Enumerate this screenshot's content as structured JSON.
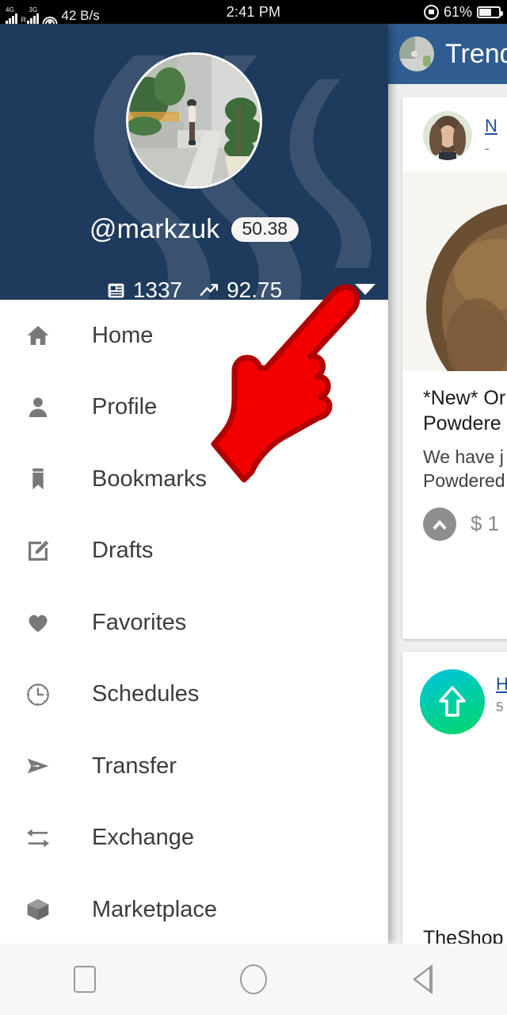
{
  "status_bar": {
    "network_4g": "4G",
    "network_3g": "3G",
    "roaming": "R",
    "data_rate": "42 B/s",
    "clock": "2:41 PM",
    "battery_percent": "61%",
    "icons": [
      "signal-4g-icon",
      "signal-3g-icon",
      "wifi-icon",
      "rotation-lock-icon",
      "battery-icon"
    ]
  },
  "drawer": {
    "profile": {
      "username": "@markzuk",
      "reputation": "50.38",
      "post_count": "1337",
      "voting_power": "92.75",
      "post_count_icon": "article-icon",
      "voting_power_icon": "trending-up-icon",
      "expand_icon": "caret-down-icon"
    },
    "menu": [
      {
        "label": "Home",
        "icon": "home-icon"
      },
      {
        "label": "Profile",
        "icon": "person-icon"
      },
      {
        "label": "Bookmarks",
        "icon": "bookmark-icon"
      },
      {
        "label": "Drafts",
        "icon": "edit-square-icon"
      },
      {
        "label": "Favorites",
        "icon": "heart-icon"
      },
      {
        "label": "Schedules",
        "icon": "clock-icon"
      },
      {
        "label": "Transfer",
        "icon": "send-arrow-icon"
      },
      {
        "label": "Exchange",
        "icon": "swap-arrows-icon"
      },
      {
        "label": "Marketplace",
        "icon": "cube-box-icon"
      }
    ]
  },
  "app_behind": {
    "app_bar": {
      "title": "Trend",
      "avatar_icon": "user-avatar"
    },
    "posts": [
      {
        "author": "N",
        "subtitle": "-",
        "title_line1": "*New* Or",
        "title_line2": "Powdere",
        "body_line1": "We have j",
        "body_line2": "Powdered",
        "upvote_icon": "upvote-chevron-icon",
        "payout": "$ 1"
      },
      {
        "author": "H",
        "subtitle": "5",
        "avatar_icon": "up-arrow-gradient-icon",
        "shop_name": "TheShop"
      }
    ]
  },
  "pointer": {
    "icon": "pointing-hand-cursor"
  },
  "nav_bar": {
    "recents_icon": "square-recents-icon",
    "home_icon": "circle-home-icon",
    "back_icon": "triangle-back-icon"
  },
  "colors": {
    "status_bar_bg": "#000000",
    "drawer_header_bg": "#1e3a5c",
    "app_bar_bg": "#2f5d91",
    "page_bg": "#eeeeee",
    "pointer_red": "#f20000",
    "link_blue": "#1a4ea8",
    "gradient_start": "#00c4e0",
    "gradient_end": "#06d86a"
  }
}
